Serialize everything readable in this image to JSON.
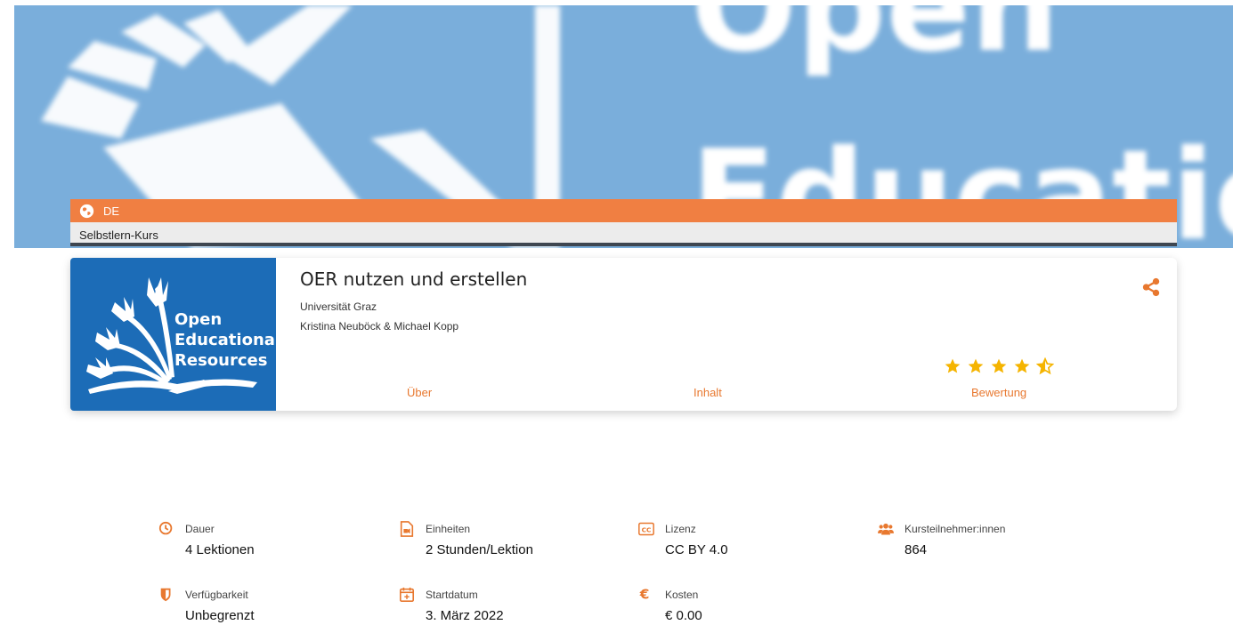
{
  "banner": {
    "word1": "Open",
    "word2": "Educatio"
  },
  "language_bar": {
    "icon": "globe-icon",
    "language": "DE",
    "color": "#f07f42"
  },
  "course_type": "Selbstlern-Kurs",
  "course": {
    "logo_lines": [
      "Open",
      "Educational",
      "Resources"
    ],
    "title": "OER nutzen und erstellen",
    "university": "Universität Graz",
    "authors": "Kristina Neuböck & Michael Kopp",
    "rating": {
      "value": 4.5,
      "max": 5
    },
    "tabs": [
      {
        "label": "Über"
      },
      {
        "label": "Inhalt"
      },
      {
        "label": "Bewertung"
      }
    ],
    "accent_color": "#e8782f",
    "star_color": "#f5b400"
  },
  "stats": [
    {
      "icon": "clock-icon",
      "label": "Dauer",
      "value": "4 Lektionen"
    },
    {
      "icon": "video-file-icon",
      "label": "Einheiten",
      "value": "2 Stunden/Lektion"
    },
    {
      "icon": "cc-license-icon",
      "label": "Lizenz",
      "value": "CC BY 4.0"
    },
    {
      "icon": "users-icon",
      "label": "Kursteilnehmer:innen",
      "value": "864"
    },
    {
      "icon": "shield-icon",
      "label": "Verfügbarkeit",
      "value": "Unbegrenzt"
    },
    {
      "icon": "calendar-plus-icon",
      "label": "Startdatum",
      "value": "3. März 2022"
    },
    {
      "icon": "euro-icon",
      "label": "Kosten",
      "value": "€ 0.00"
    }
  ]
}
